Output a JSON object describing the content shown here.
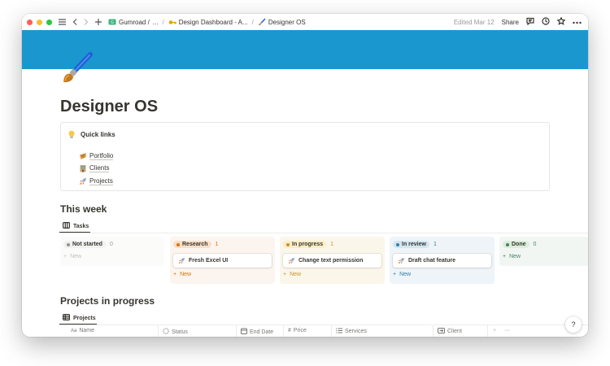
{
  "window": {
    "traffic_lights": [
      "#ff5f57",
      "#febc2e",
      "#28c840"
    ]
  },
  "topbar": {
    "breadcrumbs": [
      {
        "label": "Gumroad /",
        "icon": "gumroad-badge-icon"
      },
      {
        "label": "...",
        "icon": ""
      },
      {
        "label": "Design Dashboard - A...",
        "icon": "key-icon"
      },
      {
        "label": "Designer OS",
        "icon": "paintbrush-icon"
      }
    ],
    "edited": "Edited Mar 12",
    "share_label": "Share"
  },
  "cover_color": "#1b97cf",
  "page": {
    "icon": "paintbrush-icon",
    "title": "Designer OS"
  },
  "quick_links": {
    "icon": "lightbulb-icon",
    "heading": "Quick links",
    "items": [
      {
        "label": "Portfolio",
        "icon": "palette-icon"
      },
      {
        "label": "Clients",
        "icon": "office-building-icon"
      },
      {
        "label": "Projects",
        "icon": "rocket-icon"
      }
    ]
  },
  "this_week": {
    "heading": "This week",
    "view_label": "Tasks",
    "new_label": "New",
    "columns": [
      {
        "status": "Not started",
        "count": "0",
        "color": "#91918e",
        "bg": "#ffffff",
        "pill_bg": "#f1f1ef",
        "card": null
      },
      {
        "status": "Research",
        "count": "1",
        "color": "#d9730d",
        "bg": "#fcf5ef",
        "pill_bg": "#fadec9",
        "card": "Fresh Excel UI"
      },
      {
        "status": "In progress",
        "count": "1",
        "color": "#cb912f",
        "bg": "#fbf6ea",
        "pill_bg": "#fbedc7",
        "card": "Change text permission"
      },
      {
        "status": "In review",
        "count": "1",
        "color": "#337ea9",
        "bg": "#eef4f8",
        "pill_bg": "#d3e5ef",
        "card": "Draft chat feature"
      },
      {
        "status": "Done",
        "count": "0",
        "color": "#448361",
        "bg": "#f2f6f3",
        "pill_bg": "#dbeddb",
        "card": null
      }
    ]
  },
  "projects": {
    "heading": "Projects in progress",
    "view_label": "Projects",
    "columns": [
      {
        "label": "Name",
        "icon": "text-aa-icon"
      },
      {
        "label": "Status",
        "icon": "status-spinner-icon"
      },
      {
        "label": "End Date",
        "icon": "calendar-icon"
      },
      {
        "label": "Price",
        "icon": "hash-icon"
      },
      {
        "label": "Services",
        "icon": "list-icon"
      },
      {
        "label": "Client",
        "icon": "relation-icon"
      }
    ]
  },
  "help_label": "?"
}
